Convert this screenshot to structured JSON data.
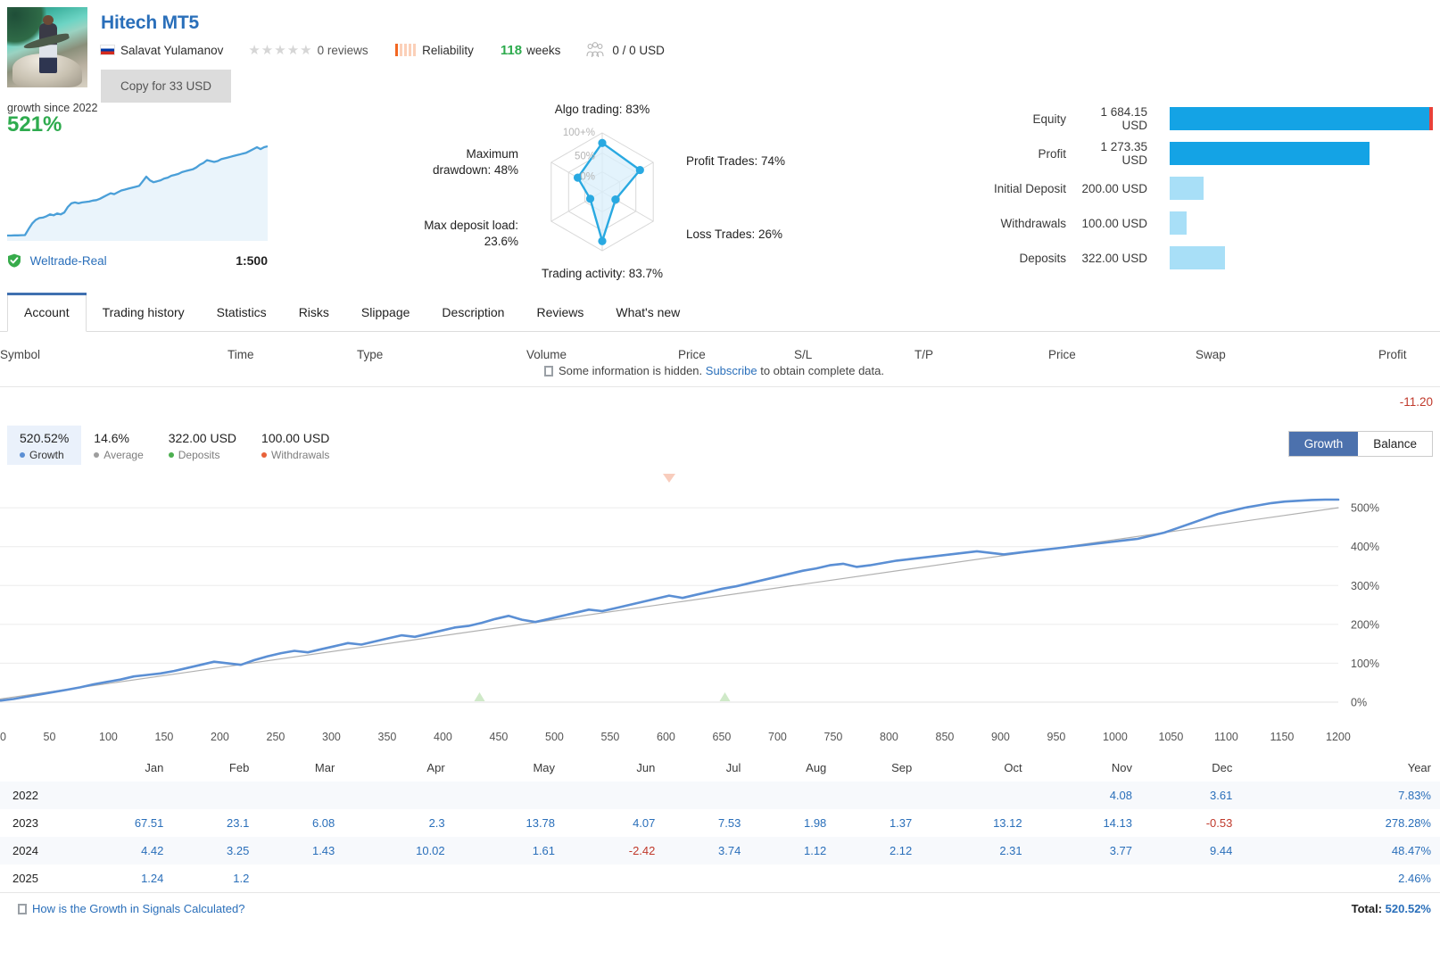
{
  "header": {
    "title": "Hitech MT5",
    "author": "Salavat Yulamanov",
    "flag_icon": "russia-flag-icon",
    "reviews": "0 reviews",
    "stars": 5,
    "reliability_label": "Reliability",
    "weeks_value": "118",
    "weeks_label": "weeks",
    "subscribers": "0 / 0 USD",
    "copy_button": "Copy for 33 USD",
    "accent_blue": "#2a6fba",
    "green": "#2eab4e",
    "reliability_color": "#f26722"
  },
  "summary": {
    "growth_since_label": "growth since 2022",
    "growth_pct": "521%",
    "broker": "Weltrade-Real",
    "leverage": "1:500",
    "sparkline": [
      3,
      3,
      3.2,
      3.2,
      3.4,
      3.5,
      10,
      16,
      20,
      22,
      22.5,
      24,
      26,
      25,
      27,
      26,
      28,
      34,
      38,
      39,
      38,
      39,
      39.5,
      40,
      41,
      41.5,
      43,
      45,
      47,
      49,
      48,
      50,
      52,
      53,
      54,
      55,
      56,
      57,
      62,
      67,
      63,
      61,
      62,
      63,
      65,
      66,
      68,
      69,
      70,
      72,
      73,
      74,
      75,
      77,
      80,
      82,
      85,
      84,
      83,
      84,
      86,
      87,
      88,
      89,
      90,
      91,
      92,
      93,
      95,
      97,
      99,
      97,
      99,
      100
    ]
  },
  "radar": {
    "axes": [
      {
        "label": "Algo trading: 83%",
        "value": 83
      },
      {
        "label": "Profit Trades: 74%",
        "value": 74
      },
      {
        "label": "Loss Trades: 26%",
        "value": 26
      },
      {
        "label": "Trading activity: 83.7%",
        "value": 83.7
      },
      {
        "label": "Max deposit load: 23.6%",
        "value": 23.6
      },
      {
        "label": "Maximum drawdown: 48%",
        "value": 48
      }
    ],
    "ring_labels": [
      "100+%",
      "50%",
      "0%"
    ],
    "color": "#29a9e1"
  },
  "bars": {
    "rows": [
      {
        "label": "Equity",
        "value": "1 684.15 USD",
        "pct": 100,
        "shade": "dark",
        "cap": true
      },
      {
        "label": "Profit",
        "value": "1 273.35 USD",
        "pct": 76,
        "shade": "dark",
        "cap": false
      },
      {
        "label": "Initial Deposit",
        "value": "200.00 USD",
        "pct": 13,
        "shade": "light",
        "cap": false
      },
      {
        "label": "Withdrawals",
        "value": "100.00 USD",
        "pct": 6.5,
        "shade": "light",
        "cap": false
      },
      {
        "label": "Deposits",
        "value": "322.00 USD",
        "pct": 21,
        "shade": "light",
        "cap": false
      }
    ],
    "dark_color": "#14a3e5",
    "light_color": "#a8dff7",
    "cap_color": "#e8413a"
  },
  "tabs": {
    "items": [
      "Account",
      "Trading history",
      "Statistics",
      "Risks",
      "Slippage",
      "Description",
      "Reviews",
      "What's new"
    ],
    "active": "Account"
  },
  "trade_table": {
    "columns": [
      "Symbol",
      "Time",
      "Type",
      "Volume",
      "Price",
      "S/L",
      "T/P",
      "Price",
      "Swap",
      "Profit"
    ],
    "hidden_notice_pre": "Some information is hidden.",
    "hidden_notice_link": "Subscribe",
    "hidden_notice_post": "to obtain complete data.",
    "total_profit": "-11.20"
  },
  "growth_legend": {
    "items": [
      {
        "value": "520.52%",
        "name": "Growth",
        "color": "#5b8fd4",
        "selected": true
      },
      {
        "value": "14.6%",
        "name": "Average",
        "color": "#9e9e9e",
        "selected": false
      },
      {
        "value": "322.00 USD",
        "name": "Deposits",
        "color": "#4caf50",
        "selected": false
      },
      {
        "value": "100.00 USD",
        "name": "Withdrawals",
        "color": "#e8623a",
        "selected": false
      }
    ],
    "toggle": {
      "on": "Growth",
      "off": "Balance"
    }
  },
  "chart_data": {
    "type": "line",
    "title": "",
    "xlabel": "",
    "ylabel": "",
    "xlim": [
      0,
      1200
    ],
    "ylim": [
      0,
      560
    ],
    "xticks": [
      0,
      50,
      100,
      150,
      200,
      250,
      300,
      350,
      400,
      450,
      500,
      550,
      600,
      650,
      700,
      750,
      800,
      850,
      900,
      950,
      1000,
      1050,
      1100,
      1150,
      1200
    ],
    "yticks": [
      0,
      100,
      200,
      300,
      400,
      500
    ],
    "ytick_labels": [
      "0%",
      "100%",
      "200%",
      "300%",
      "400%",
      "500%"
    ],
    "grid": true,
    "legend_position": "top-left",
    "markers": [
      {
        "x": 430,
        "type": "deposit",
        "color": "#cfe9c8",
        "shape": "triangle-up"
      },
      {
        "x": 650,
        "type": "deposit",
        "color": "#cfe9c8",
        "shape": "triangle-up"
      },
      {
        "x": 600,
        "type": "withdrawal",
        "color": "#f8cdbd",
        "shape": "triangle-down"
      }
    ],
    "series": [
      {
        "name": "Growth",
        "color": "#5b8fd4",
        "x": [
          0,
          12,
          24,
          36,
          48,
          60,
          72,
          84,
          96,
          108,
          120,
          132,
          144,
          156,
          168,
          180,
          192,
          204,
          216,
          228,
          240,
          252,
          264,
          276,
          288,
          300,
          312,
          324,
          336,
          348,
          360,
          372,
          384,
          396,
          408,
          420,
          432,
          444,
          456,
          468,
          480,
          492,
          504,
          516,
          528,
          540,
          552,
          564,
          576,
          588,
          600,
          612,
          624,
          636,
          648,
          660,
          672,
          684,
          696,
          708,
          720,
          732,
          744,
          756,
          768,
          780,
          792,
          804,
          816,
          828,
          840,
          852,
          864,
          876,
          888,
          900,
          912,
          924,
          936,
          948,
          960,
          972,
          984,
          996,
          1008,
          1020,
          1032,
          1044,
          1056,
          1068,
          1080,
          1092,
          1104,
          1116,
          1128,
          1140,
          1152,
          1164,
          1176,
          1188,
          1200
        ],
        "y": [
          4,
          8,
          14,
          20,
          26,
          32,
          38,
          46,
          52,
          58,
          66,
          70,
          74,
          80,
          88,
          96,
          104,
          100,
          96,
          108,
          118,
          126,
          132,
          128,
          136,
          144,
          152,
          148,
          156,
          164,
          172,
          168,
          176,
          184,
          192,
          196,
          204,
          214,
          222,
          212,
          206,
          214,
          222,
          230,
          238,
          234,
          242,
          250,
          258,
          266,
          274,
          268,
          276,
          284,
          292,
          298,
          306,
          314,
          322,
          330,
          338,
          344,
          352,
          356,
          348,
          352,
          358,
          364,
          368,
          372,
          376,
          380,
          384,
          388,
          384,
          380,
          384,
          388,
          392,
          396,
          400,
          404,
          408,
          412,
          416,
          420,
          428,
          436,
          448,
          460,
          472,
          484,
          492,
          500,
          506,
          512,
          516,
          518,
          520,
          521,
          521
        ]
      },
      {
        "name": "Average",
        "color": "#9e9e9e",
        "x": [
          0,
          1200
        ],
        "y": [
          8,
          500
        ]
      }
    ]
  },
  "monthly": {
    "months": [
      "Jan",
      "Feb",
      "Mar",
      "Apr",
      "May",
      "Jun",
      "Jul",
      "Aug",
      "Sep",
      "Oct",
      "Nov",
      "Dec"
    ],
    "year_header": "Year",
    "rows": [
      {
        "year": "2022",
        "values": [
          "",
          "",
          "",
          "",
          "",
          "",
          "",
          "",
          "",
          "",
          "4.08",
          "3.61"
        ],
        "total": "7.83%"
      },
      {
        "year": "2023",
        "values": [
          "67.51",
          "23.1",
          "6.08",
          "2.3",
          "13.78",
          "4.07",
          "7.53",
          "1.98",
          "1.37",
          "13.12",
          "14.13",
          "-0.53"
        ],
        "total": "278.28%"
      },
      {
        "year": "2024",
        "values": [
          "4.42",
          "3.25",
          "1.43",
          "10.02",
          "1.61",
          "-2.42",
          "3.74",
          "1.12",
          "2.12",
          "2.31",
          "3.77",
          "9.44"
        ],
        "total": "48.47%"
      },
      {
        "year": "2025",
        "values": [
          "1.24",
          "1.2",
          "",
          "",
          "",
          "",
          "",
          "",
          "",
          "",
          "",
          ""
        ],
        "total": "2.46%"
      }
    ],
    "footer_link": "How is the Growth in Signals Calculated?",
    "total_label": "Total:",
    "total_value": "520.52%"
  }
}
